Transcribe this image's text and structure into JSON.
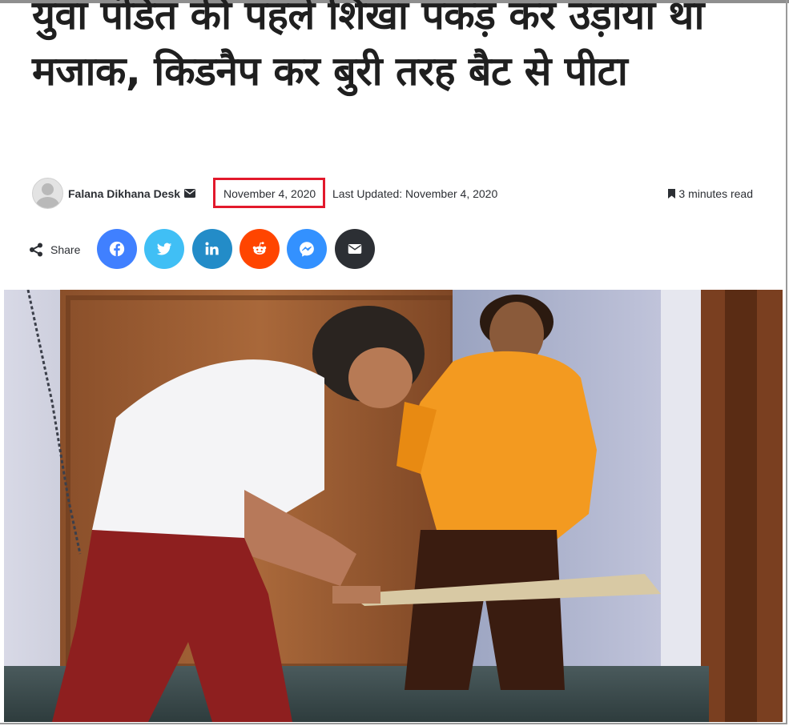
{
  "article": {
    "title": "युवा पंडित की पहले शिखा पकड़ कर उड़ाया था मजाक, किडनैप कर बुरी तरह बैट से पीटा",
    "author": "Falana Dikhana Desk",
    "published_date": "November 4, 2020",
    "last_updated": "Last Updated: November 4, 2020",
    "read_time": "3 minutes read"
  },
  "share": {
    "label": "Share",
    "buttons": [
      {
        "name": "facebook",
        "icon": "facebook-icon",
        "color": "#4080ff"
      },
      {
        "name": "twitter",
        "icon": "twitter-icon",
        "color": "#40bff5"
      },
      {
        "name": "linkedin",
        "icon": "linkedin-icon",
        "color": "#238cc8"
      },
      {
        "name": "reddit",
        "icon": "reddit-icon",
        "color": "#ff4500"
      },
      {
        "name": "messenger",
        "icon": "messenger-icon",
        "color": "#3391ff"
      },
      {
        "name": "email",
        "icon": "envelope-icon",
        "color": "#2c2f34"
      }
    ]
  },
  "highlight_color": "#e2192c"
}
